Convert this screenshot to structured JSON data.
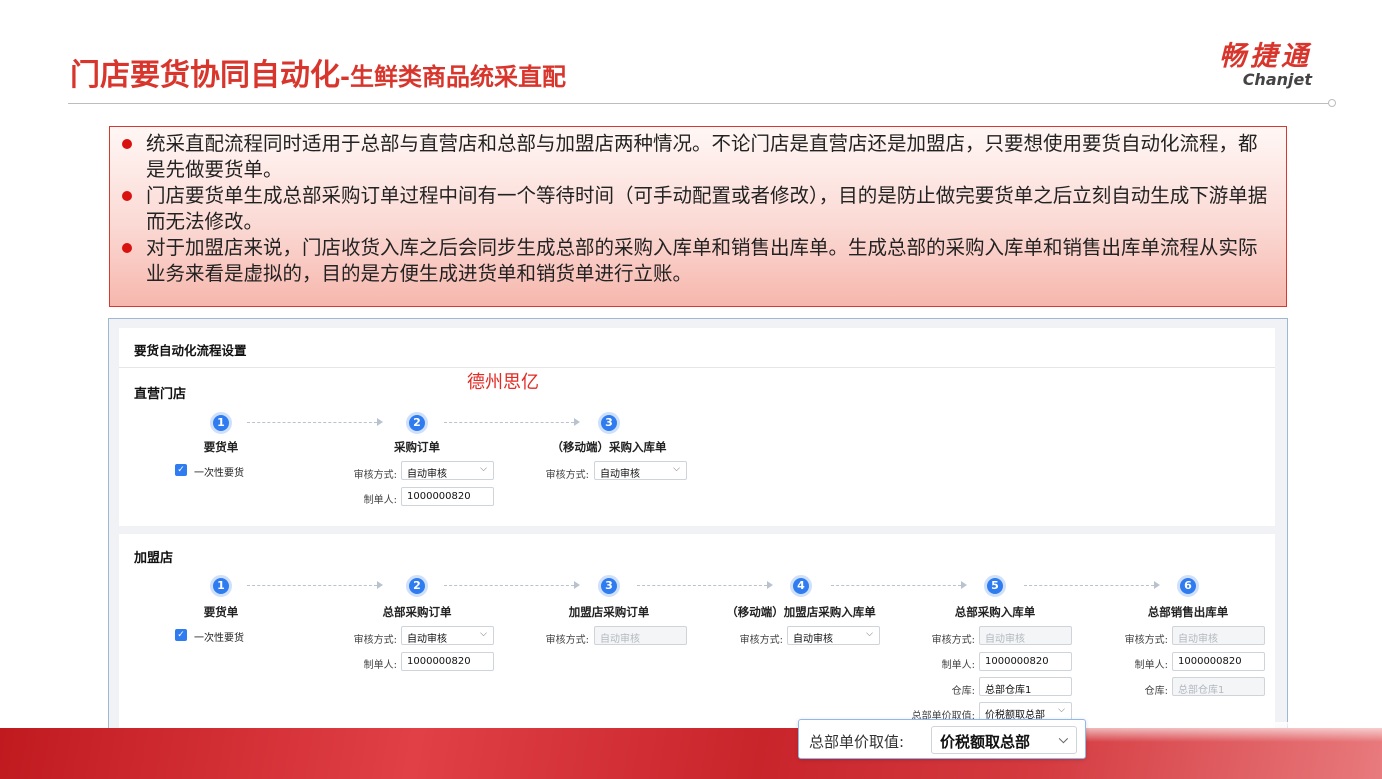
{
  "slide": {
    "title_main": "门店要货协同自动化",
    "title_sub": "-生鲜类商品统采直配",
    "logo_cn": "畅捷通",
    "logo_en": "Chanjet",
    "notes": [
      "统采直配流程同时适用于总部与直营店和总部与加盟店两种情况。不论门店是直营店还是加盟店，只要想使用要货自动化流程，都是先做要货单。",
      "门店要货单生成总部采购订单过程中间有一个等待时间（可手动配置或者修改），目的是防止做完要货单之后立刻自动生成下游单据而无法修改。",
      "对于加盟店来说，门店收货入库之后会同步生成总部的采购入库单和销售出库单。生成总部的采购入库单和销售出库单流程从实际业务来看是虚拟的，目的是方便生成进货单和销货单进行立账。"
    ],
    "watermark": "德州思亿"
  },
  "settings": {
    "title": "要货自动化流程设置",
    "direct": {
      "title": "直营门店",
      "steps": [
        {
          "num": "1",
          "label": "要货单"
        },
        {
          "num": "2",
          "label": "采购订单"
        },
        {
          "num": "3",
          "label": "（移动端）采购入库单"
        }
      ],
      "checkbox_label": "一次性要货",
      "review_label": "审核方式:",
      "review_value": "自动审核",
      "review_value_3": "自动审核",
      "maker_label": "制单人:",
      "maker_value": "1000000820"
    },
    "franchise": {
      "title": "加盟店",
      "steps": [
        {
          "num": "1",
          "label": "要货单"
        },
        {
          "num": "2",
          "label": "总部采购订单"
        },
        {
          "num": "3",
          "label": "加盟店采购订单"
        },
        {
          "num": "4",
          "label": "（移动端）加盟店采购入库单"
        },
        {
          "num": "5",
          "label": "总部采购入库单"
        },
        {
          "num": "6",
          "label": "总部销售出库单"
        }
      ],
      "checkbox_label": "一次性要货",
      "review_label": "审核方式:",
      "review_auto": "自动审核",
      "maker_label": "制单人:",
      "maker_value": "1000000820",
      "warehouse_label": "仓库:",
      "warehouse_value": "总部仓库1",
      "price_label": "总部单价取值:",
      "price_value": "价税额取总部"
    }
  },
  "zoom_callout": {
    "label": "总部单价取值:",
    "value": "价税额取总部"
  }
}
